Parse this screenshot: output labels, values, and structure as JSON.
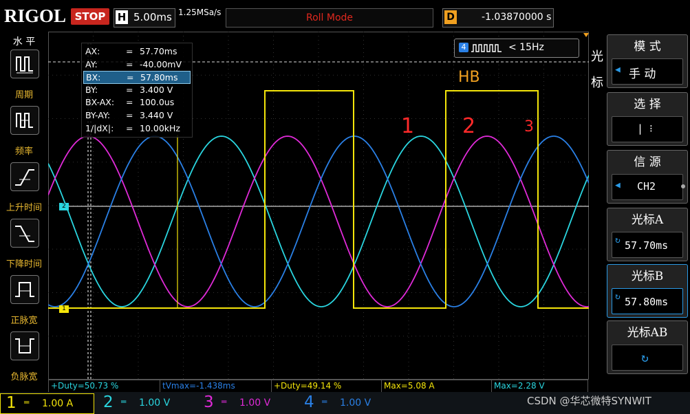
{
  "header": {
    "brand": "RIGOL",
    "run_state": "STOP",
    "timebase_key": "H",
    "timebase": "5.00ms",
    "sample_rate": "1.25MSa/s",
    "mode": "Roll Mode",
    "delay_key": "D",
    "delay": "-1.03870000 s"
  },
  "left_menu": {
    "title": "水 平",
    "items": [
      {
        "label": "周期",
        "icon": "period-icon"
      },
      {
        "label": "频率",
        "icon": "frequency-icon"
      },
      {
        "label": "上升时间",
        "icon": "rise-time-icon"
      },
      {
        "label": "下降时间",
        "icon": "fall-time-icon"
      },
      {
        "label": "正脉宽",
        "icon": "positive-width-icon"
      },
      {
        "label": "负脉宽",
        "icon": "negative-width-icon"
      }
    ]
  },
  "cursor_readout": {
    "rows": [
      {
        "k": "AX:",
        "v": "57.70ms"
      },
      {
        "k": "AY:",
        "v": "-40.00mV"
      },
      {
        "k": "BX:",
        "v": "57.80ms"
      },
      {
        "k": "BY:",
        "v": "3.400 V"
      },
      {
        "k": "BX-AX:",
        "v": "100.0us"
      },
      {
        "k": "BY-AY:",
        "v": "3.440 V"
      },
      {
        "k": "1/|dX|:",
        "v": "10.00kHz"
      }
    ],
    "highlight_row": 2
  },
  "trigger_box": {
    "channel": "4",
    "text": "< 15Hz"
  },
  "annotations": {
    "hb": "HB",
    "n1": "1",
    "n2": "2",
    "n3": "3"
  },
  "channel_markers": {
    "ch1": "1",
    "ch2": "2"
  },
  "right_menu": {
    "mode": {
      "title": "模 式",
      "value": "手 动"
    },
    "select": {
      "title": "选 择",
      "value": "|   ⁝"
    },
    "source": {
      "title": "信 源",
      "value": "CH2"
    },
    "cursor_a": {
      "title": "光标A",
      "value": "57.70ms"
    },
    "cursor_b": {
      "title": "光标B",
      "value": "57.80ms"
    },
    "cursor_ab": {
      "title": "光标AB"
    },
    "side_label_1": "光",
    "side_label_2": "标"
  },
  "measurements": [
    "+Duty=50.73 %",
    "tVmax=-1.438ms",
    "+Duty=49.14 %",
    "Max=5.08 A",
    "Max=2.28 V"
  ],
  "channels": [
    {
      "num": "1",
      "coupling": "═",
      "scale": "1.00 A",
      "color": "#f5e60a",
      "active": true
    },
    {
      "num": "2",
      "coupling": "═",
      "scale": "1.00 V",
      "color": "#2ad6e0",
      "active": false
    },
    {
      "num": "3",
      "coupling": "═",
      "scale": "1.00 V",
      "color": "#e02ad8",
      "active": false
    },
    {
      "num": "4",
      "coupling": "═",
      "scale": "1.00 V",
      "color": "#2a80e6",
      "active": false
    }
  ],
  "watermark": "CSDN @华芯微特SYNWIT",
  "colors": {
    "ch1": "#f5e60a",
    "ch2": "#2ad6e0",
    "ch3": "#e02ad8",
    "ch4": "#2a80e6",
    "accent": "#f0a020",
    "annotation_red": "#ff2a2a"
  }
}
